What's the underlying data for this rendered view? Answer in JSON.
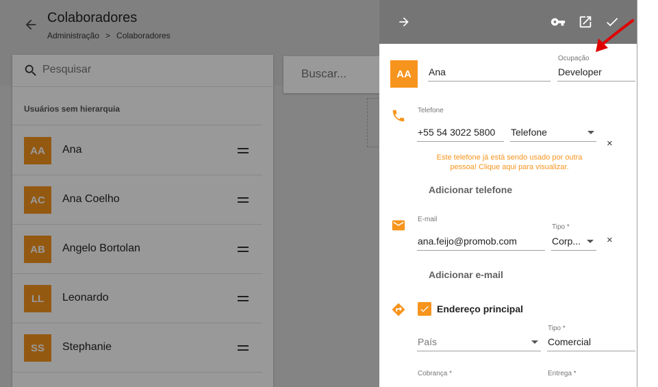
{
  "background": {
    "title": "Colaboradores",
    "breadcrumb": [
      "Administração",
      ">",
      "Colaboradores"
    ],
    "search_placeholder": "Pesquisar",
    "section_title": "Usuários sem hierarquia",
    "buscar_placeholder": "Buscar...",
    "users": [
      {
        "initials": "AA",
        "name": "Ana"
      },
      {
        "initials": "AC",
        "name": "Ana Coelho"
      },
      {
        "initials": "AB",
        "name": "Angelo Bortolan"
      },
      {
        "initials": "LL",
        "name": "Leonardo"
      },
      {
        "initials": "SS",
        "name": "Stephanie"
      }
    ]
  },
  "panel": {
    "avatar_initials": "AA",
    "name_value": "Ana",
    "occupation_label": "Ocupação",
    "occupation_value": "Developer",
    "phone": {
      "label": "Telefone",
      "number": "+55 54 3022 5800",
      "type": "Telefone",
      "error": "Este telefone já está sendo usado por outra pessoa! Clique aqui para visualizar.",
      "add_label": "Adicionar telefone"
    },
    "email": {
      "label": "E-mail",
      "value": "ana.feijo@promob.com",
      "type_label": "Tipo *",
      "type_value": "Corp...",
      "add_label": "Adicionar e-mail"
    },
    "address": {
      "checkbox_label": "Endereço principal",
      "country_placeholder": "País",
      "type_label": "Tipo *",
      "type_value": "Comercial",
      "billing_label": "Cobrança *",
      "delivery_label": "Entrega *"
    },
    "close_symbol": "×"
  },
  "colors": {
    "accent": "#f7941d",
    "header": "#757575",
    "annotation_arrow": "#e00000"
  }
}
